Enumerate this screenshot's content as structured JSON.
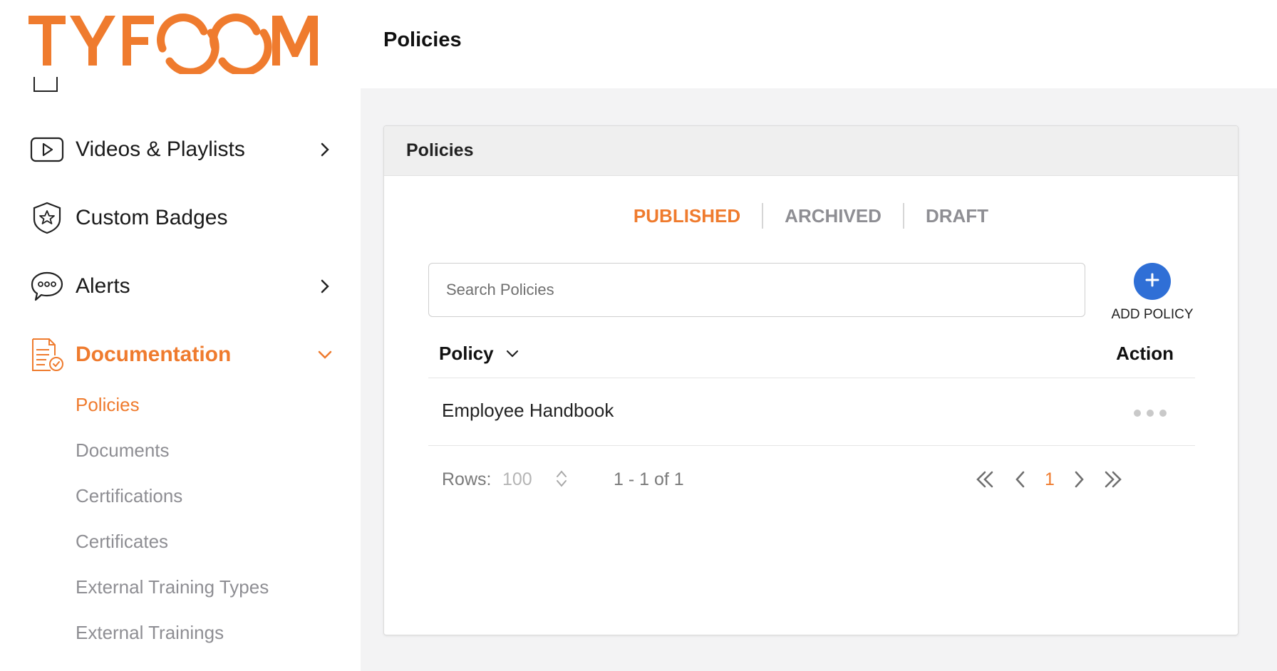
{
  "brand": {
    "logo_text": "TYFOOM",
    "accent": "#ef7b2e",
    "button_blue": "#2f6fd6"
  },
  "sidebar": {
    "items": [
      {
        "label": "Videos & Playlists",
        "icon": "video-icon",
        "has_chevron": true
      },
      {
        "label": "Custom Badges",
        "icon": "shield-star-icon",
        "has_chevron": false
      },
      {
        "label": "Alerts",
        "icon": "chat-bubble-icon",
        "has_chevron": true
      },
      {
        "label": "Documentation",
        "icon": "document-check-icon",
        "has_chevron": true,
        "expanded": true,
        "active": true
      }
    ],
    "sub_items": [
      {
        "label": "Policies",
        "active": true
      },
      {
        "label": "Documents",
        "active": false
      },
      {
        "label": "Certifications",
        "active": false
      },
      {
        "label": "Certificates",
        "active": false
      },
      {
        "label": "External Training Types",
        "active": false
      },
      {
        "label": "External Trainings",
        "active": false
      }
    ]
  },
  "header": {
    "title": "Policies"
  },
  "card": {
    "title": "Policies",
    "tabs": [
      {
        "label": "PUBLISHED",
        "active": true
      },
      {
        "label": "ARCHIVED",
        "active": false
      },
      {
        "label": "DRAFT",
        "active": false
      }
    ],
    "search": {
      "placeholder": "Search Policies",
      "value": ""
    },
    "add_button": {
      "label": "ADD POLICY",
      "icon": "plus-icon"
    },
    "table": {
      "columns": [
        "Policy",
        "Action"
      ],
      "rows": [
        {
          "policy": "Employee Handbook",
          "action_icon": "more-dots-icon"
        }
      ]
    },
    "pagination": {
      "rows_label": "Rows:",
      "rows_value": "100",
      "range_text": "1 - 1 of 1",
      "current_page": "1"
    }
  }
}
